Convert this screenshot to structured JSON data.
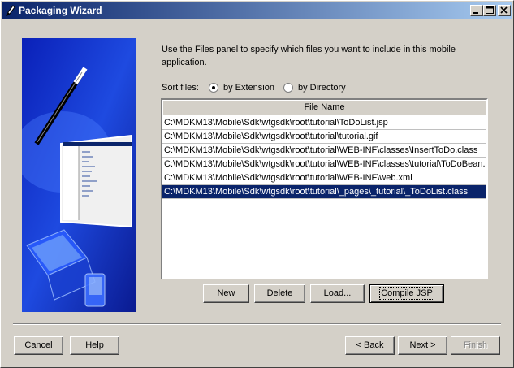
{
  "window": {
    "title": "Packaging Wizard",
    "icon": "pencil-icon"
  },
  "instructions": "Use the Files panel to specify which files you want to include in this mobile application.",
  "sort": {
    "label": "Sort files:",
    "options": [
      {
        "label": "by Extension",
        "checked": true
      },
      {
        "label": "by Directory",
        "checked": false
      }
    ]
  },
  "file_table": {
    "column_header": "File Name",
    "rows": [
      "C:\\MDKM13\\Mobile\\Sdk\\wtgsdk\\root\\tutorial\\ToDoList.jsp",
      "C:\\MDKM13\\Mobile\\Sdk\\wtgsdk\\root\\tutorial\\tutorial.gif",
      "C:\\MDKM13\\Mobile\\Sdk\\wtgsdk\\root\\tutorial\\WEB-INF\\classes\\InsertToDo.class",
      "C:\\MDKM13\\Mobile\\Sdk\\wtgsdk\\root\\tutorial\\WEB-INF\\classes\\tutorial\\ToDoBean.c...",
      "C:\\MDKM13\\Mobile\\Sdk\\wtgsdk\\root\\tutorial\\WEB-INF\\web.xml",
      "C:\\MDKM13\\Mobile\\Sdk\\wtgsdk\\root\\tutorial\\_pages\\_tutorial\\_ToDoList.class"
    ],
    "selected_row": 5
  },
  "list_buttons": {
    "new": "New",
    "delete": "Delete",
    "load": "Load...",
    "compile": "Compile JSP"
  },
  "footer_buttons": {
    "cancel": "Cancel",
    "help": "Help",
    "back": "< Back",
    "next": "Next >",
    "finish": "Finish"
  },
  "colors": {
    "titlebar_start": "#0a246a",
    "titlebar_end": "#a6caf0",
    "selection": "#0a246a",
    "illustration_blue": "#1a3fd8"
  }
}
